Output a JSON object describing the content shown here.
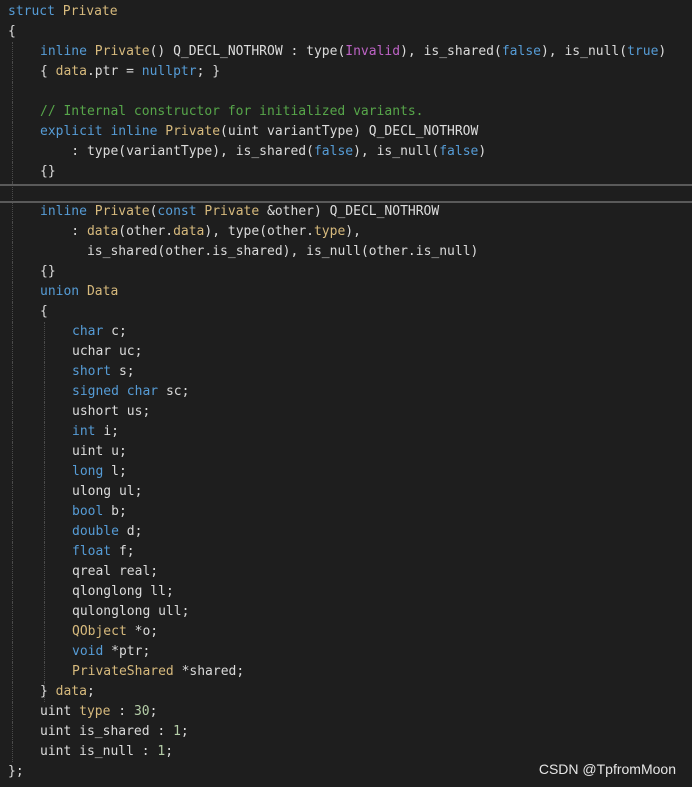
{
  "colors": {
    "background": "#1e1e1e",
    "keyword": "#569cd6",
    "type": "#d7ba7d",
    "member": "#dadada",
    "comment": "#57a64a",
    "enum_value": "#bd63c5"
  },
  "code_lines": [
    {
      "indent": 0,
      "tokens": [
        {
          "t": "struct",
          "c": "kw"
        },
        {
          "t": " ",
          "c": "tx"
        },
        {
          "t": "Private",
          "c": "ty"
        }
      ]
    },
    {
      "indent": 0,
      "tokens": [
        {
          "t": "{",
          "c": "tx"
        }
      ]
    },
    {
      "indent": 1,
      "tokens": [
        {
          "t": "inline",
          "c": "kw"
        },
        {
          "t": " ",
          "c": "tx"
        },
        {
          "t": "Private",
          "c": "ty"
        },
        {
          "t": "() Q_DECL_NOTHROW : ",
          "c": "tx"
        },
        {
          "t": "type",
          "c": "mem"
        },
        {
          "t": "(",
          "c": "tx"
        },
        {
          "t": "Invalid",
          "c": "mac"
        },
        {
          "t": "), ",
          "c": "tx"
        },
        {
          "t": "is_shared",
          "c": "mem"
        },
        {
          "t": "(",
          "c": "tx"
        },
        {
          "t": "false",
          "c": "kw"
        },
        {
          "t": "), ",
          "c": "tx"
        },
        {
          "t": "is_null",
          "c": "mem"
        },
        {
          "t": "(",
          "c": "tx"
        },
        {
          "t": "true",
          "c": "kw"
        },
        {
          "t": ")",
          "c": "tx"
        }
      ]
    },
    {
      "indent": 1,
      "tokens": [
        {
          "t": "{ ",
          "c": "tx"
        },
        {
          "t": "data",
          "c": "ty"
        },
        {
          "t": ".",
          "c": "tx"
        },
        {
          "t": "ptr",
          "c": "mem"
        },
        {
          "t": " = ",
          "c": "tx"
        },
        {
          "t": "nullptr",
          "c": "kw"
        },
        {
          "t": "; }",
          "c": "tx"
        }
      ]
    },
    {
      "indent": 0,
      "tokens": []
    },
    {
      "indent": 1,
      "tokens": [
        {
          "t": "// Internal constructor for initialized variants.",
          "c": "cm"
        }
      ]
    },
    {
      "indent": 1,
      "tokens": [
        {
          "t": "explicit",
          "c": "kw"
        },
        {
          "t": " ",
          "c": "tx"
        },
        {
          "t": "inline",
          "c": "kw"
        },
        {
          "t": " ",
          "c": "tx"
        },
        {
          "t": "Private",
          "c": "ty"
        },
        {
          "t": "(uint ",
          "c": "tx"
        },
        {
          "t": "variantType",
          "c": "mem"
        },
        {
          "t": ") Q_DECL_NOTHROW",
          "c": "tx"
        }
      ]
    },
    {
      "indent": 1,
      "tokens": [
        {
          "t": "    : ",
          "c": "tx"
        },
        {
          "t": "type",
          "c": "mem"
        },
        {
          "t": "(",
          "c": "tx"
        },
        {
          "t": "variantType",
          "c": "mem"
        },
        {
          "t": "), ",
          "c": "tx"
        },
        {
          "t": "is_shared",
          "c": "mem"
        },
        {
          "t": "(",
          "c": "tx"
        },
        {
          "t": "false",
          "c": "kw"
        },
        {
          "t": "), ",
          "c": "tx"
        },
        {
          "t": "is_null",
          "c": "mem"
        },
        {
          "t": "(",
          "c": "tx"
        },
        {
          "t": "false",
          "c": "kw"
        },
        {
          "t": ")",
          "c": "tx"
        }
      ]
    },
    {
      "indent": 1,
      "tokens": [
        {
          "t": "{}",
          "c": "tx"
        }
      ]
    },
    {
      "indent": 0,
      "tokens": []
    },
    {
      "indent": 1,
      "tokens": [
        {
          "t": "inline",
          "c": "kw"
        },
        {
          "t": " ",
          "c": "tx"
        },
        {
          "t": "Private",
          "c": "ty"
        },
        {
          "t": "(",
          "c": "tx"
        },
        {
          "t": "const",
          "c": "kw"
        },
        {
          "t": " ",
          "c": "tx"
        },
        {
          "t": "Private",
          "c": "ty"
        },
        {
          "t": " &",
          "c": "tx"
        },
        {
          "t": "other",
          "c": "mem"
        },
        {
          "t": ") Q_DECL_NOTHROW",
          "c": "tx"
        }
      ]
    },
    {
      "indent": 1,
      "tokens": [
        {
          "t": "    : ",
          "c": "tx"
        },
        {
          "t": "data",
          "c": "ty"
        },
        {
          "t": "(",
          "c": "tx"
        },
        {
          "t": "other",
          "c": "mem"
        },
        {
          "t": ".",
          "c": "tx"
        },
        {
          "t": "data",
          "c": "ty"
        },
        {
          "t": "), ",
          "c": "tx"
        },
        {
          "t": "type",
          "c": "mem"
        },
        {
          "t": "(",
          "c": "tx"
        },
        {
          "t": "other",
          "c": "mem"
        },
        {
          "t": ".",
          "c": "tx"
        },
        {
          "t": "type",
          "c": "ty"
        },
        {
          "t": "),",
          "c": "tx"
        }
      ]
    },
    {
      "indent": 1,
      "tokens": [
        {
          "t": "      ",
          "c": "tx"
        },
        {
          "t": "is_shared",
          "c": "mem"
        },
        {
          "t": "(",
          "c": "tx"
        },
        {
          "t": "other",
          "c": "mem"
        },
        {
          "t": ".",
          "c": "tx"
        },
        {
          "t": "is_shared",
          "c": "mem"
        },
        {
          "t": "), ",
          "c": "tx"
        },
        {
          "t": "is_null",
          "c": "mem"
        },
        {
          "t": "(",
          "c": "tx"
        },
        {
          "t": "other",
          "c": "mem"
        },
        {
          "t": ".",
          "c": "tx"
        },
        {
          "t": "is_null",
          "c": "mem"
        },
        {
          "t": ")",
          "c": "tx"
        }
      ]
    },
    {
      "indent": 1,
      "tokens": [
        {
          "t": "{}",
          "c": "tx"
        }
      ]
    },
    {
      "indent": 1,
      "tokens": [
        {
          "t": "union",
          "c": "kw"
        },
        {
          "t": " ",
          "c": "tx"
        },
        {
          "t": "Data",
          "c": "ty"
        }
      ]
    },
    {
      "indent": 1,
      "tokens": [
        {
          "t": "{",
          "c": "tx"
        }
      ]
    },
    {
      "indent": 2,
      "tokens": [
        {
          "t": "char",
          "c": "kw"
        },
        {
          "t": " ",
          "c": "tx"
        },
        {
          "t": "c",
          "c": "mem"
        },
        {
          "t": ";",
          "c": "tx"
        }
      ]
    },
    {
      "indent": 2,
      "tokens": [
        {
          "t": "uchar ",
          "c": "tx"
        },
        {
          "t": "uc",
          "c": "mem"
        },
        {
          "t": ";",
          "c": "tx"
        }
      ]
    },
    {
      "indent": 2,
      "tokens": [
        {
          "t": "short",
          "c": "kw"
        },
        {
          "t": " ",
          "c": "tx"
        },
        {
          "t": "s",
          "c": "mem"
        },
        {
          "t": ";",
          "c": "tx"
        }
      ]
    },
    {
      "indent": 2,
      "tokens": [
        {
          "t": "signed",
          "c": "kw"
        },
        {
          "t": " ",
          "c": "tx"
        },
        {
          "t": "char",
          "c": "kw"
        },
        {
          "t": " ",
          "c": "tx"
        },
        {
          "t": "sc",
          "c": "mem"
        },
        {
          "t": ";",
          "c": "tx"
        }
      ]
    },
    {
      "indent": 2,
      "tokens": [
        {
          "t": "ushort ",
          "c": "tx"
        },
        {
          "t": "us",
          "c": "mem"
        },
        {
          "t": ";",
          "c": "tx"
        }
      ]
    },
    {
      "indent": 2,
      "tokens": [
        {
          "t": "int",
          "c": "kw"
        },
        {
          "t": " ",
          "c": "tx"
        },
        {
          "t": "i",
          "c": "mem"
        },
        {
          "t": ";",
          "c": "tx"
        }
      ]
    },
    {
      "indent": 2,
      "tokens": [
        {
          "t": "uint ",
          "c": "tx"
        },
        {
          "t": "u",
          "c": "mem"
        },
        {
          "t": ";",
          "c": "tx"
        }
      ]
    },
    {
      "indent": 2,
      "tokens": [
        {
          "t": "long",
          "c": "kw"
        },
        {
          "t": " ",
          "c": "tx"
        },
        {
          "t": "l",
          "c": "mem"
        },
        {
          "t": ";",
          "c": "tx"
        }
      ]
    },
    {
      "indent": 2,
      "tokens": [
        {
          "t": "ulong ",
          "c": "tx"
        },
        {
          "t": "ul",
          "c": "mem"
        },
        {
          "t": ";",
          "c": "tx"
        }
      ]
    },
    {
      "indent": 2,
      "tokens": [
        {
          "t": "bool",
          "c": "kw"
        },
        {
          "t": " ",
          "c": "tx"
        },
        {
          "t": "b",
          "c": "mem"
        },
        {
          "t": ";",
          "c": "tx"
        }
      ]
    },
    {
      "indent": 2,
      "tokens": [
        {
          "t": "double",
          "c": "kw"
        },
        {
          "t": " ",
          "c": "tx"
        },
        {
          "t": "d",
          "c": "mem"
        },
        {
          "t": ";",
          "c": "tx"
        }
      ]
    },
    {
      "indent": 2,
      "tokens": [
        {
          "t": "float",
          "c": "kw"
        },
        {
          "t": " ",
          "c": "tx"
        },
        {
          "t": "f",
          "c": "mem"
        },
        {
          "t": ";",
          "c": "tx"
        }
      ]
    },
    {
      "indent": 2,
      "tokens": [
        {
          "t": "qreal ",
          "c": "tx"
        },
        {
          "t": "real",
          "c": "mem"
        },
        {
          "t": ";",
          "c": "tx"
        }
      ]
    },
    {
      "indent": 2,
      "tokens": [
        {
          "t": "qlonglong ",
          "c": "tx"
        },
        {
          "t": "ll",
          "c": "mem"
        },
        {
          "t": ";",
          "c": "tx"
        }
      ]
    },
    {
      "indent": 2,
      "tokens": [
        {
          "t": "qulonglong ",
          "c": "tx"
        },
        {
          "t": "ull",
          "c": "mem"
        },
        {
          "t": ";",
          "c": "tx"
        }
      ]
    },
    {
      "indent": 2,
      "tokens": [
        {
          "t": "QObject",
          "c": "ty"
        },
        {
          "t": " *",
          "c": "tx"
        },
        {
          "t": "o",
          "c": "mem"
        },
        {
          "t": ";",
          "c": "tx"
        }
      ]
    },
    {
      "indent": 2,
      "tokens": [
        {
          "t": "void",
          "c": "kw"
        },
        {
          "t": " *",
          "c": "tx"
        },
        {
          "t": "ptr",
          "c": "mem"
        },
        {
          "t": ";",
          "c": "tx"
        }
      ]
    },
    {
      "indent": 2,
      "tokens": [
        {
          "t": "PrivateShared",
          "c": "ty"
        },
        {
          "t": " *",
          "c": "tx"
        },
        {
          "t": "shared",
          "c": "mem"
        },
        {
          "t": ";",
          "c": "tx"
        }
      ]
    },
    {
      "indent": 1,
      "tokens": [
        {
          "t": "} ",
          "c": "tx"
        },
        {
          "t": "data",
          "c": "ty"
        },
        {
          "t": ";",
          "c": "tx"
        }
      ]
    },
    {
      "indent": 1,
      "tokens": [
        {
          "t": "uint ",
          "c": "tx"
        },
        {
          "t": "type",
          "c": "ty"
        },
        {
          "t": " : ",
          "c": "tx"
        },
        {
          "t": "30",
          "c": "num"
        },
        {
          "t": ";",
          "c": "tx"
        }
      ]
    },
    {
      "indent": 1,
      "tokens": [
        {
          "t": "uint ",
          "c": "tx"
        },
        {
          "t": "is_shared",
          "c": "mem"
        },
        {
          "t": " : ",
          "c": "tx"
        },
        {
          "t": "1",
          "c": "num"
        },
        {
          "t": ";",
          "c": "tx"
        }
      ]
    },
    {
      "indent": 1,
      "tokens": [
        {
          "t": "uint ",
          "c": "tx"
        },
        {
          "t": "is_null",
          "c": "mem"
        },
        {
          "t": " : ",
          "c": "tx"
        },
        {
          "t": "1",
          "c": "num"
        },
        {
          "t": ";",
          "c": "tx"
        }
      ]
    },
    {
      "indent": 0,
      "tokens": [
        {
          "t": "};",
          "c": "tx"
        }
      ]
    }
  ],
  "watermark": "CSDN @TpfromMoon"
}
